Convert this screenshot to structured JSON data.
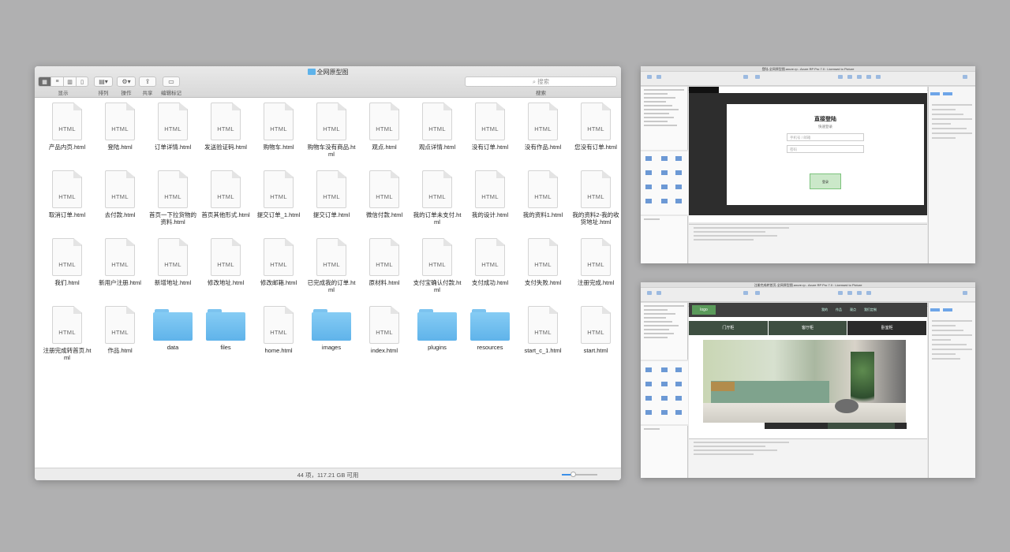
{
  "finder": {
    "title": "全网原型图",
    "toolbar": {
      "display_label": "显示",
      "arrange_label": "排列",
      "action_label": "操作",
      "share_label": "共享",
      "tags_label": "编辑标记",
      "search_placeholder": "搜索",
      "search_label": "搜索"
    },
    "file_type_label": "HTML",
    "items": [
      {
        "name": "产品内页.html",
        "kind": "file"
      },
      {
        "name": "登陆.html",
        "kind": "file"
      },
      {
        "name": "订单详情.html",
        "kind": "file"
      },
      {
        "name": "发送验证码.html",
        "kind": "file"
      },
      {
        "name": "购物车.html",
        "kind": "file"
      },
      {
        "name": "购物车没有商品.html",
        "kind": "file"
      },
      {
        "name": "观点.html",
        "kind": "file"
      },
      {
        "name": "观点详情.html",
        "kind": "file"
      },
      {
        "name": "没有订单.html",
        "kind": "file"
      },
      {
        "name": "没有作品.html",
        "kind": "file"
      },
      {
        "name": "您没有订单.html",
        "kind": "file"
      },
      {
        "name": "取消订单.html",
        "kind": "file"
      },
      {
        "name": "去付款.html",
        "kind": "file"
      },
      {
        "name": "首页一下拉货物的资料.html",
        "kind": "file"
      },
      {
        "name": "首页其他形式.html",
        "kind": "file"
      },
      {
        "name": "提交订单_1.html",
        "kind": "file"
      },
      {
        "name": "提交订单.html",
        "kind": "file"
      },
      {
        "name": "微信付款.html",
        "kind": "file"
      },
      {
        "name": "我的订单未支付.html",
        "kind": "file"
      },
      {
        "name": "我的设计.html",
        "kind": "file"
      },
      {
        "name": "我的资料1.html",
        "kind": "file"
      },
      {
        "name": "我的资料2-我的收货地址.html",
        "kind": "file"
      },
      {
        "name": "我们.html",
        "kind": "file"
      },
      {
        "name": "新用户注册.html",
        "kind": "file"
      },
      {
        "name": "新增地址.html",
        "kind": "file"
      },
      {
        "name": "修改地址.html",
        "kind": "file"
      },
      {
        "name": "修改邮箱.html",
        "kind": "file"
      },
      {
        "name": "已完成我的订单.html",
        "kind": "file"
      },
      {
        "name": "原材料.html",
        "kind": "file"
      },
      {
        "name": "支付宝确认付款.html",
        "kind": "file"
      },
      {
        "name": "支付成功.html",
        "kind": "file"
      },
      {
        "name": "支付失败.html",
        "kind": "file"
      },
      {
        "name": "注册完成.html",
        "kind": "file"
      },
      {
        "name": "注册完成转首页.html",
        "kind": "file"
      },
      {
        "name": "作品.html",
        "kind": "file"
      },
      {
        "name": "data",
        "kind": "folder"
      },
      {
        "name": "files",
        "kind": "folder"
      },
      {
        "name": "home.html",
        "kind": "file"
      },
      {
        "name": "images",
        "kind": "folder"
      },
      {
        "name": "index.html",
        "kind": "file"
      },
      {
        "name": "plugins",
        "kind": "folder"
      },
      {
        "name": "resources",
        "kind": "folder"
      },
      {
        "name": "start_c_1.html",
        "kind": "file"
      },
      {
        "name": "start.html",
        "kind": "file"
      }
    ],
    "status_text": "44 项，117.21 GB 可用",
    "icon_size_fraction": 0.3,
    "folder_color": "#5fb3ea"
  },
  "axure_top": {
    "window_title": "登陆-全网原型图.axure.rp - Axure RP Pro 7.0 : Licensed to Picture",
    "modal_title": "直接登陆",
    "modal_subtitle": "快速登录",
    "field_phone": "手机号 / 邮箱",
    "field_password": "密码",
    "button_label": "登录"
  },
  "axure_bottom": {
    "window_title": "注册完成转首页-全网原型图.axure.rp - Axure RP Pro 7.0 : Licensed to Picture",
    "logo_text": "logo",
    "nav_links": [
      "我的",
      "作品",
      "观点",
      "我们定制"
    ],
    "tabs": [
      "门厅柜",
      "客厅柜",
      "卧室柜"
    ]
  }
}
